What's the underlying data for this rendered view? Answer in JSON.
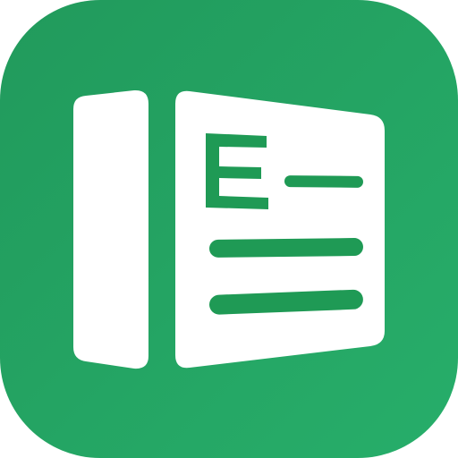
{
  "icon": {
    "name": "spreadsheet-app-icon",
    "glyph": "E",
    "colors": {
      "background_start": "#219A5C",
      "background_end": "#27AE6A",
      "foreground": "#FFFFFF",
      "accent": "#1F9A55"
    }
  }
}
